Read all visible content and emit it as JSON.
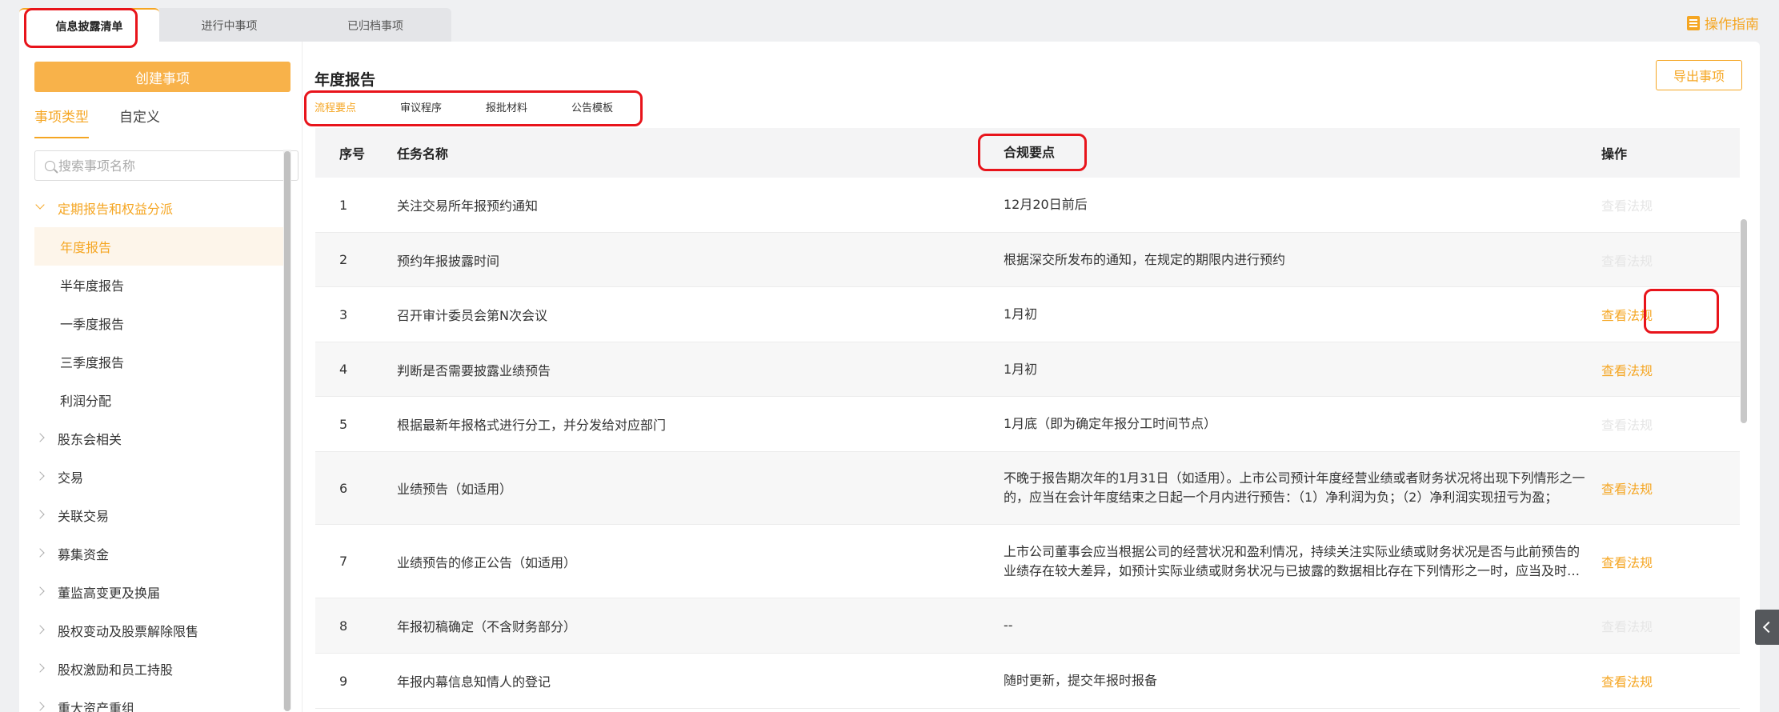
{
  "top_tabs": [
    {
      "label": "信息披露清单"
    },
    {
      "label": "进行中事项"
    },
    {
      "label": "已归档事项"
    }
  ],
  "guide_label": "操作指南",
  "sidebar": {
    "create_label": "创建事项",
    "tabs": [
      {
        "label": "事项类型"
      },
      {
        "label": "自定义"
      }
    ],
    "search_placeholder": "搜索事项名称",
    "tree": [
      {
        "label": "定期报告和权益分派"
      },
      {
        "label": "年度报告"
      },
      {
        "label": "半年度报告"
      },
      {
        "label": "一季度报告"
      },
      {
        "label": "三季度报告"
      },
      {
        "label": "利润分配"
      },
      {
        "label": "股东会相关"
      },
      {
        "label": "交易"
      },
      {
        "label": "关联交易"
      },
      {
        "label": "募集资金"
      },
      {
        "label": "董监高变更及换届"
      },
      {
        "label": "股权变动及股票解除限售"
      },
      {
        "label": "股权激励和员工持股"
      },
      {
        "label": "重大资产重组"
      }
    ]
  },
  "main": {
    "title": "年度报告",
    "export_label": "导出事项",
    "sub_tabs": [
      {
        "label": "流程要点"
      },
      {
        "label": "审议程序"
      },
      {
        "label": "报批材料"
      },
      {
        "label": "公告模板"
      }
    ],
    "columns": {
      "no": "序号",
      "name": "任务名称",
      "key": "合规要点",
      "op": "操作"
    },
    "rows": [
      {
        "no": "1",
        "name": "关注交易所年报预约通知",
        "key": "12月20日前后",
        "op": "查看法规"
      },
      {
        "no": "2",
        "name": "预约年报披露时间",
        "key": "根据深交所发布的通知，在规定的期限内进行预约",
        "op": "查看法规"
      },
      {
        "no": "3",
        "name": "召开审计委员会第N次会议",
        "key": "1月初",
        "op": "查看法规"
      },
      {
        "no": "4",
        "name": "判断是否需要披露业绩预告",
        "key": "1月初",
        "op": "查看法规"
      },
      {
        "no": "5",
        "name": "根据最新年报格式进行分工，并分发给对应部门",
        "key": "1月底（即为确定年报分工时间节点）",
        "op": "查看法规"
      },
      {
        "no": "6",
        "name": "业绩预告（如适用）",
        "key": "不晚于报告期次年的1月31日（如适用）。上市公司预计年度经营业绩或者财务状况将出现下列情形之一的，应当在会计年度结束之日起一个月内进行预告：（1）净利润为负；（2）净利润实现扭亏为盈；",
        "op": "查看法规"
      },
      {
        "no": "7",
        "name": "业绩预告的修正公告（如适用）",
        "key": "上市公司董事会应当根据公司的经营状况和盈利情况，持续关注实际业绩或财务状况是否与此前预告的业绩存在较大差异，如预计实际业绩或财务状况与已披露的数据相比存在下列情形之一时，应当及时披露业绩预告修正公告。",
        "op": "查看法规"
      },
      {
        "no": "8",
        "name": "年报初稿确定（不含财务部分）",
        "key": "--",
        "op": "查看法规"
      },
      {
        "no": "9",
        "name": "年报内幕信息知情人的登记",
        "key": "随时更新，提交年报时报备",
        "op": "查看法规"
      }
    ]
  },
  "colors": {
    "accent": "#f5a623",
    "highlight": "#e8141b"
  }
}
